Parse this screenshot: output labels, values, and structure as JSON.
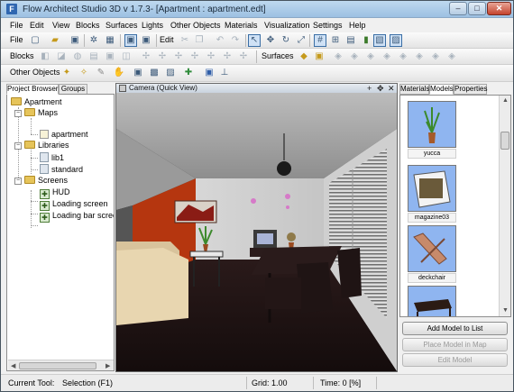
{
  "window": {
    "title": "Flow Architect Studio 3D v 1.7.3- [Apartment : apartment.edt]",
    "app_icon_letter": "F",
    "controls": {
      "minimize": "–",
      "maximize": "□",
      "close": "✕"
    }
  },
  "menu": [
    "File",
    "Edit",
    "View",
    "Blocks",
    "Surfaces",
    "Lights",
    "Other Objects",
    "Materials",
    "Visualization",
    "Settings",
    "Help"
  ],
  "toolbars": {
    "file_label": "File",
    "edit_label": "Edit",
    "blocks_label": "Blocks",
    "surfaces_label": "Surfaces",
    "other_objects_label": "Other Objects"
  },
  "left_panel": {
    "tabs": [
      "Project Browser",
      "Groups"
    ],
    "active_tab": "Project Browser",
    "tree": {
      "root": "Apartment",
      "maps": "Maps",
      "map_item": "apartment",
      "libraries": "Libraries",
      "lib1": "lib1",
      "standard": "standard",
      "screens": "Screens",
      "hud": "HUD",
      "loading_screen": "Loading screen",
      "loading_bar_screen": "Loading bar screen"
    }
  },
  "viewport": {
    "title": "Camera (Quick View)",
    "buttons": {
      "add": "+",
      "move": "✥",
      "close": "✕"
    }
  },
  "right_panel": {
    "tabs": [
      "Materials",
      "Models",
      "Properties"
    ],
    "active_tab": "Models",
    "models": [
      "yucca",
      "magazine03",
      "deckchair",
      ""
    ],
    "buttons": {
      "add_model": "Add Model to List",
      "place_model": "Place Model in Map",
      "edit_model": "Edit Model"
    }
  },
  "status": {
    "current_tool_label": "Current Tool:",
    "current_tool_value": "Selection (F1)",
    "grid": "Grid: 1.00",
    "time": "Time: 0 [%]"
  },
  "colors": {
    "titlebar": "#a9c8e6",
    "accent_wall": "#b5360f",
    "floor": "#1c1313",
    "sofa": "#d8c39c"
  }
}
